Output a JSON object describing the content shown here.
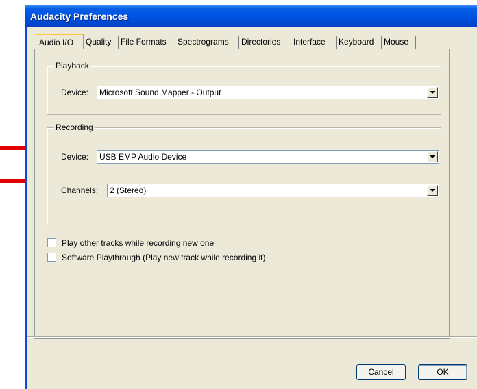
{
  "window": {
    "title": "Audacity Preferences"
  },
  "tabs": [
    {
      "label": "Audio I/O",
      "active": true
    },
    {
      "label": "Quality"
    },
    {
      "label": "File Formats"
    },
    {
      "label": "Spectrograms"
    },
    {
      "label": "Directories"
    },
    {
      "label": "Interface"
    },
    {
      "label": "Keyboard"
    },
    {
      "label": "Mouse"
    }
  ],
  "playback": {
    "group_label": "Playback",
    "device_label": "Device:",
    "device_value": "Microsoft Sound Mapper - Output"
  },
  "recording": {
    "group_label": "Recording",
    "device_label": "Device:",
    "device_value": "USB EMP Audio Device",
    "channels_label": "Channels:",
    "channels_value": "2 (Stereo)"
  },
  "options": [
    {
      "label": "Play other tracks while recording new one",
      "checked": false
    },
    {
      "label": "Software Playthrough (Play new track while recording it)",
      "checked": false
    }
  ],
  "buttons": {
    "cancel": "Cancel",
    "ok": "OK"
  },
  "colors": {
    "annotation_arrow": "#e00000",
    "title_bar": "#0054e3"
  }
}
